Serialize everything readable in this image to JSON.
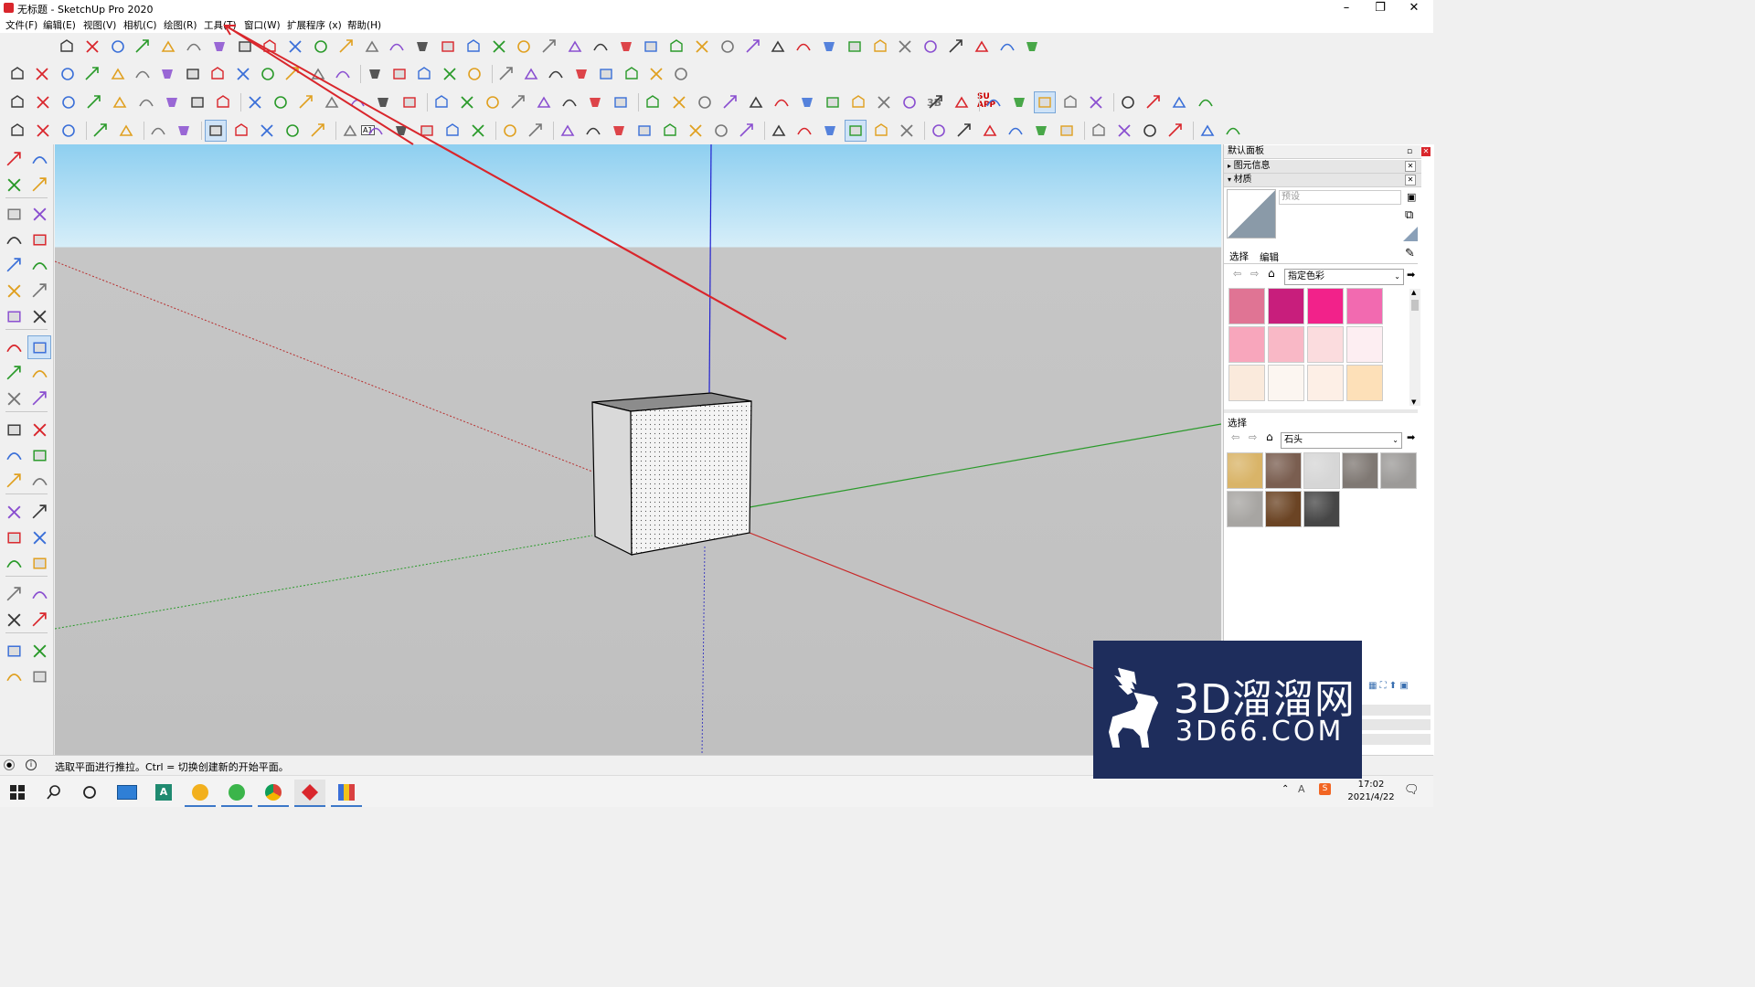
{
  "window": {
    "title": "无标题 - SketchUp Pro 2020",
    "minimize": "–",
    "maximize": "❐",
    "close": "✕"
  },
  "menu": [
    "文件(F)",
    "编辑(E)",
    "视图(V)",
    "相机(C)",
    "绘图(R)",
    "工具(T)",
    "窗口(W)",
    "扩展程序 (x)",
    "帮助(H)"
  ],
  "toolbar": {
    "row3_labels": [
      "3B",
      "SU APP"
    ],
    "row4_tool_label": "A1"
  },
  "panel": {
    "tray_title": "默认面板",
    "entity_info": "图元信息",
    "materials": "材质",
    "material_name_placeholder": "预设",
    "tab_select": "选择",
    "tab_edit": "编辑",
    "library_select": "指定色彩",
    "swatches": [
      "#e07494",
      "#c81e7c",
      "#f2228a",
      "#f26ab0",
      "#f8a6bc",
      "#f9b8c6",
      "#fbdcde",
      "#fdeef2",
      "#faeadc",
      "#fcf6f1",
      "#fdefe6",
      "#fde0b8"
    ],
    "secondary_select_label": "选择",
    "secondary_library": "石头",
    "stones": [
      "#d9b468",
      "#7a5e50",
      "#d6d6d6",
      "#7f7873",
      "#9c9a98",
      "#a7a5a2",
      "#6b4424",
      "#464646"
    ]
  },
  "status": {
    "text": "选取平面进行推拉。Ctrl = 切换创建新的开始平面。"
  },
  "taskbar": {
    "time": "17:02",
    "date": "2021/4/22"
  },
  "watermark": {
    "cn": "3D溜溜网",
    "en": "3D66.COM"
  },
  "colors": {
    "accent_red": "#d9262c",
    "axis_blue": "#2020d0",
    "axis_green": "#2a9a2a",
    "axis_red": "#c82828",
    "highlight": "#cfe3f7"
  }
}
